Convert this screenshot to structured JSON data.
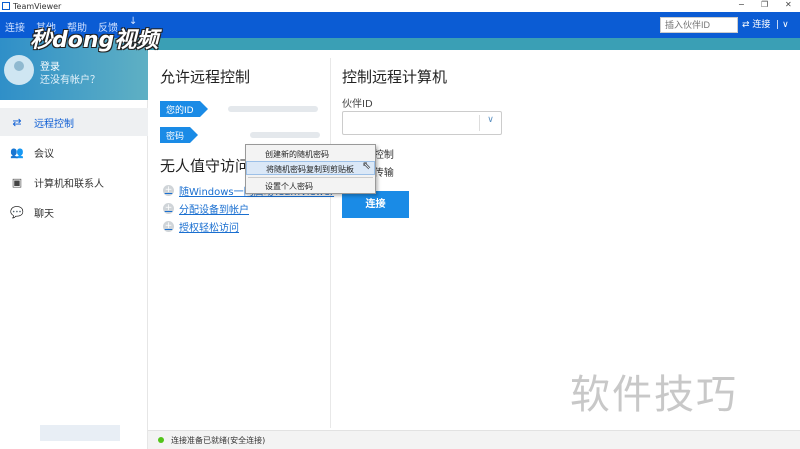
{
  "window": {
    "title": "TeamViewer",
    "min": "−",
    "max": "❐",
    "close": "✕"
  },
  "menu": [
    "连接",
    "其他",
    "帮助",
    "反馈"
  ],
  "menu_download_icon": "↓",
  "partner_input": {
    "placeholder": "插入伙伴ID"
  },
  "connect_top": {
    "icon": "⇄",
    "label": "连接",
    "chevron": "∨"
  },
  "user": {
    "login": "登录",
    "no_account": "还没有帐户？"
  },
  "sidebar": {
    "items": [
      {
        "icon": "⇄",
        "label": "远程控制"
      },
      {
        "icon": "👥",
        "label": "会议"
      },
      {
        "icon": "▣",
        "label": "计算机和联系人"
      },
      {
        "icon": "💬",
        "label": "聊天"
      }
    ]
  },
  "allow": {
    "title": "允许远程控制",
    "your_id": "您的ID",
    "password": "密码"
  },
  "unattended": {
    "title": "无人值守访问",
    "links": [
      "随Windows一同启动TeamViewer",
      "分配设备到帐户",
      "授权轻松访问"
    ],
    "plus": "+"
  },
  "control": {
    "title": "控制远程计算机",
    "partner_id_label": "伙伴ID",
    "dropdown": "∨",
    "options": [
      "远程控制",
      "文件传输"
    ],
    "connect": "连接"
  },
  "context_menu": {
    "items": [
      "创建新的随机密码",
      "将随机密码复制到剪贴板",
      "设置个人密码"
    ]
  },
  "status": "连接准备已就绪(安全连接)",
  "watermark": "软件技巧",
  "video_logo": "秒dong视频"
}
